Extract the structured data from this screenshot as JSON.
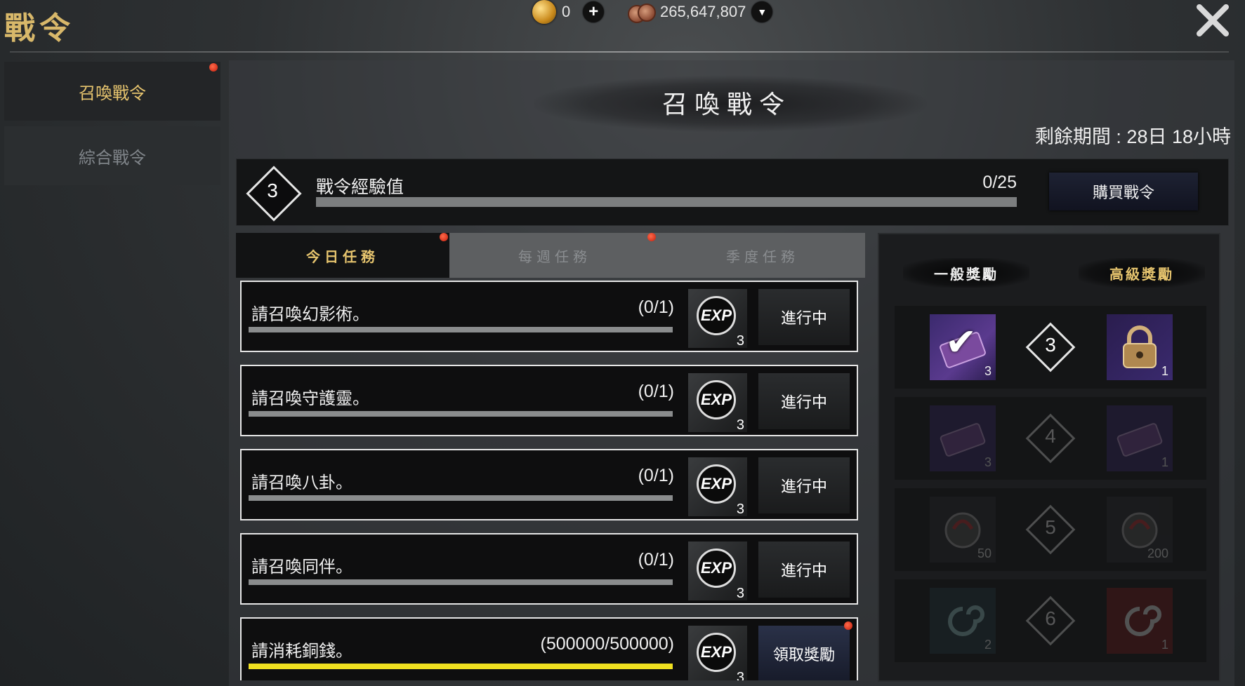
{
  "header": {
    "title": "戰令",
    "gold_amount": "0",
    "copper_amount": "265,647,807",
    "add_symbol": "+",
    "dropdown_symbol": "▼",
    "close_symbol": "✕"
  },
  "sidebar": {
    "items": [
      {
        "label": "召喚戰令",
        "selected": true,
        "has_notification": true
      },
      {
        "label": "綜合戰令",
        "selected": false,
        "has_notification": false
      }
    ]
  },
  "main": {
    "title": "召喚戰令",
    "remaining_period": "剩餘期間 : 28日 18小時",
    "level": "3",
    "exp_label": "戰令經驗值",
    "exp_value": "0/25",
    "exp_progress": 0,
    "buy_button": "購買戰令",
    "tabs": [
      {
        "label": "今日任務",
        "active": true,
        "has_notification": true
      },
      {
        "label": "每週任務",
        "active": false,
        "has_notification": true
      },
      {
        "label": "季度任務",
        "active": false,
        "has_notification": false
      }
    ],
    "quests": [
      {
        "text": "請召喚幻影術。",
        "progress": "(0/1)",
        "fraction": 0,
        "reward_icon": "exp-icon",
        "reward_label": "EXP",
        "reward_count": "3",
        "status": "進行中"
      },
      {
        "text": "請召喚守護靈。",
        "progress": "(0/1)",
        "fraction": 0,
        "reward_icon": "exp-icon",
        "reward_label": "EXP",
        "reward_count": "3",
        "status": "進行中"
      },
      {
        "text": "請召喚八卦。",
        "progress": "(0/1)",
        "fraction": 0,
        "reward_icon": "exp-icon",
        "reward_label": "EXP",
        "reward_count": "3",
        "status": "進行中"
      },
      {
        "text": "請召喚同伴。",
        "progress": "(0/1)",
        "fraction": 0,
        "reward_icon": "exp-icon",
        "reward_label": "EXP",
        "reward_count": "3",
        "status": "進行中"
      },
      {
        "text": "請消耗銅錢。",
        "progress": "(500000/500000)",
        "fraction": 1,
        "reward_icon": "exp-icon",
        "reward_label": "EXP",
        "reward_count": "3",
        "status": "領取獎勵",
        "has_notification": true
      }
    ]
  },
  "rewards": {
    "normal_header": "一般獎勵",
    "premium_header": "高級獎勵",
    "rows": [
      {
        "level": "4",
        "normal_icon": "scroll-icon",
        "normal_count": "3",
        "premium_icon": "scroll-icon",
        "premium_count": "1"
      },
      {
        "level": "5",
        "normal_icon": "potion-icon",
        "normal_count": "50",
        "premium_icon": "potion-icon",
        "premium_count": "200"
      },
      {
        "level": "6",
        "normal_icon": "swirl-icon",
        "normal_count": "2",
        "premium_icon": "swirl-icon",
        "premium_count": "1"
      }
    ],
    "current": {
      "level": "3",
      "normal_icon": "scroll-icon",
      "normal_count": "3",
      "normal_claimed": true,
      "claimed_symbol": "✔",
      "premium_icon": "lock-icon",
      "premium_count": "1"
    }
  },
  "colors": {
    "accent_gold": "#e6c46e",
    "progress_yellow": "#f0e020",
    "notification_red": "#d9321a"
  }
}
